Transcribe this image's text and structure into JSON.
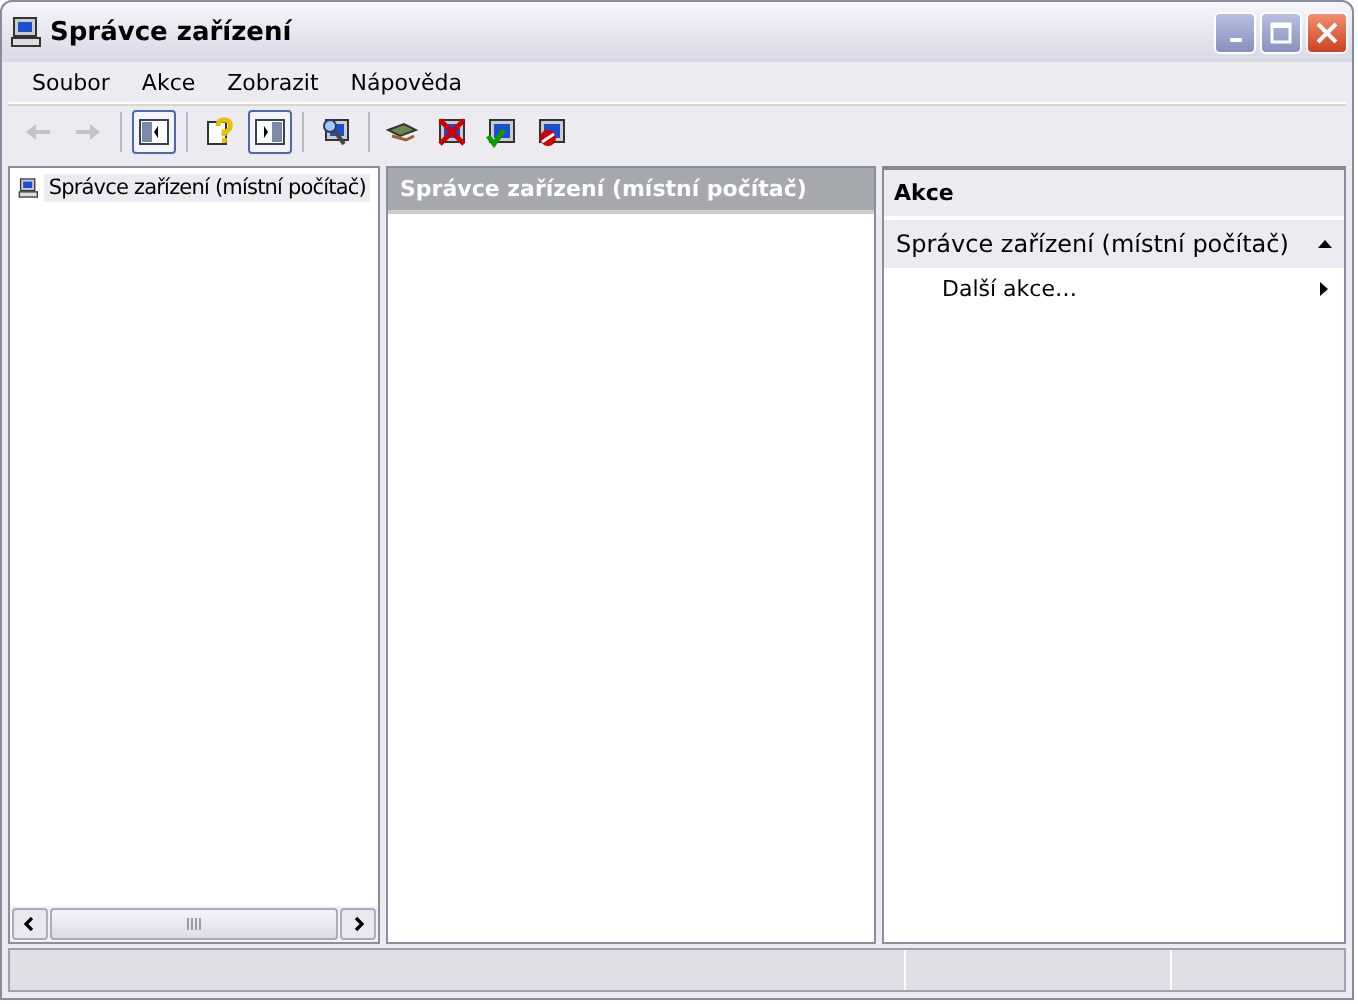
{
  "window": {
    "title": "Správce zařízení"
  },
  "menu": [
    "Soubor",
    "Akce",
    "Zobrazit",
    "Nápověda"
  ],
  "toolbar": [
    {
      "kind": "back",
      "disabled": true,
      "pressed": false
    },
    {
      "kind": "forward",
      "disabled": true,
      "pressed": false
    },
    {
      "kind": "sep"
    },
    {
      "kind": "tree",
      "disabled": false,
      "pressed": true
    },
    {
      "kind": "sep"
    },
    {
      "kind": "help",
      "disabled": false,
      "pressed": false
    },
    {
      "kind": "actionpane",
      "disabled": false,
      "pressed": true
    },
    {
      "kind": "sep"
    },
    {
      "kind": "scan",
      "disabled": false,
      "pressed": false
    },
    {
      "kind": "sep"
    },
    {
      "kind": "driver",
      "disabled": false,
      "pressed": false
    },
    {
      "kind": "uninstall",
      "disabled": false,
      "pressed": false
    },
    {
      "kind": "enable",
      "disabled": false,
      "pressed": false
    },
    {
      "kind": "disable",
      "disabled": false,
      "pressed": false
    }
  ],
  "tree": {
    "items": [
      {
        "label": "Správce zařízení (místní počítač)",
        "selected": true
      }
    ]
  },
  "center": {
    "header": "Správce zařízení (místní počítač)"
  },
  "actions": {
    "header": "Akce",
    "sections": [
      {
        "title": "Správce zařízení (místní počítač)",
        "expanded": true,
        "items": [
          {
            "label": "Další akce…",
            "submenu": true
          }
        ]
      }
    ]
  }
}
